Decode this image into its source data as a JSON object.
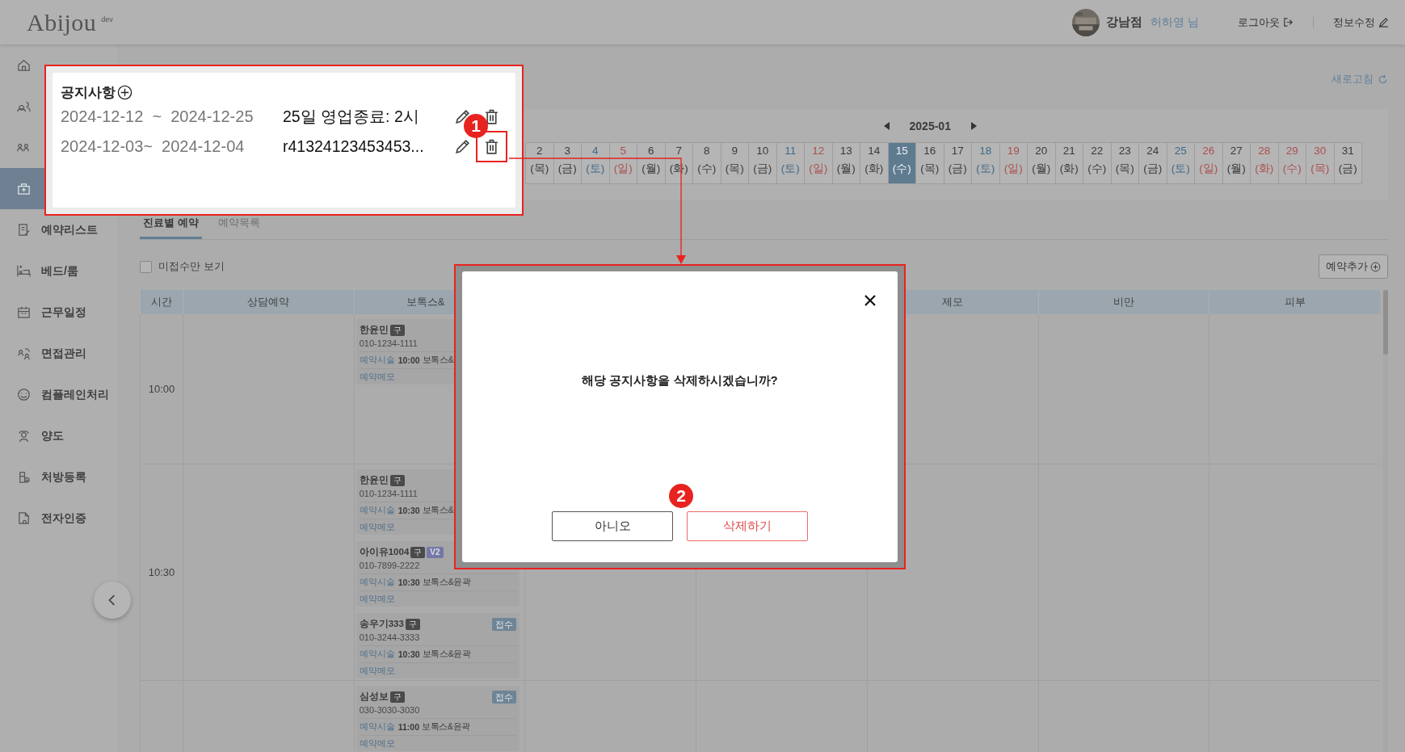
{
  "header": {
    "logo": "Abijou",
    "logo_tag": "dev",
    "branch": "강남점",
    "user": "허하영 님",
    "logout": "로그아웃",
    "edit_profile": "정보수정"
  },
  "sidebar": {
    "items": [
      {
        "selected": false
      },
      {
        "selected": false
      },
      {
        "selected": false
      },
      {
        "selected": true
      },
      {
        "label": "예약리스트",
        "selected": false
      },
      {
        "label": "베드/룸",
        "selected": false
      },
      {
        "label": "근무일정",
        "selected": false
      },
      {
        "label": "면접관리",
        "selected": false
      },
      {
        "label": "컴플레인처리",
        "selected": false
      },
      {
        "label": "양도",
        "selected": false
      },
      {
        "label": "처방등록",
        "selected": false
      },
      {
        "label": "전자인증",
        "selected": false
      }
    ]
  },
  "refresh": "새로고침",
  "calendar": {
    "month": "2025-01",
    "days": [
      {
        "day": "2",
        "weekday": "(목)",
        "kind": "weekday",
        "selected": false
      },
      {
        "day": "3",
        "weekday": "(금)",
        "kind": "weekday",
        "selected": false
      },
      {
        "day": "4",
        "weekday": "(토)",
        "kind": "saturday",
        "selected": false
      },
      {
        "day": "5",
        "weekday": "(일)",
        "kind": "holiday",
        "selected": false
      },
      {
        "day": "6",
        "weekday": "(월)",
        "kind": "weekday",
        "selected": false
      },
      {
        "day": "7",
        "weekday": "(화)",
        "kind": "weekday",
        "selected": false
      },
      {
        "day": "8",
        "weekday": "(수)",
        "kind": "weekday",
        "selected": false
      },
      {
        "day": "9",
        "weekday": "(목)",
        "kind": "weekday",
        "selected": false
      },
      {
        "day": "10",
        "weekday": "(금)",
        "kind": "weekday",
        "selected": false
      },
      {
        "day": "11",
        "weekday": "(토)",
        "kind": "saturday",
        "selected": false
      },
      {
        "day": "12",
        "weekday": "(일)",
        "kind": "holiday",
        "selected": false
      },
      {
        "day": "13",
        "weekday": "(월)",
        "kind": "weekday",
        "selected": false
      },
      {
        "day": "14",
        "weekday": "(화)",
        "kind": "weekday",
        "selected": false
      },
      {
        "day": "15",
        "weekday": "(수)",
        "kind": "weekday",
        "selected": true
      },
      {
        "day": "16",
        "weekday": "(목)",
        "kind": "weekday",
        "selected": false
      },
      {
        "day": "17",
        "weekday": "(금)",
        "kind": "weekday",
        "selected": false
      },
      {
        "day": "18",
        "weekday": "(토)",
        "kind": "saturday",
        "selected": false
      },
      {
        "day": "19",
        "weekday": "(일)",
        "kind": "holiday",
        "selected": false
      },
      {
        "day": "20",
        "weekday": "(월)",
        "kind": "weekday",
        "selected": false
      },
      {
        "day": "21",
        "weekday": "(화)",
        "kind": "weekday",
        "selected": false
      },
      {
        "day": "22",
        "weekday": "(수)",
        "kind": "weekday",
        "selected": false
      },
      {
        "day": "23",
        "weekday": "(목)",
        "kind": "weekday",
        "selected": false
      },
      {
        "day": "24",
        "weekday": "(금)",
        "kind": "weekday",
        "selected": false
      },
      {
        "day": "25",
        "weekday": "(토)",
        "kind": "saturday",
        "selected": false
      },
      {
        "day": "26",
        "weekday": "(일)",
        "kind": "holiday",
        "selected": false
      },
      {
        "day": "27",
        "weekday": "(월)",
        "kind": "weekday",
        "selected": false
      },
      {
        "day": "28",
        "weekday": "(화)",
        "kind": "holiday",
        "selected": false
      },
      {
        "day": "29",
        "weekday": "(수)",
        "kind": "holiday",
        "selected": false
      },
      {
        "day": "30",
        "weekday": "(목)",
        "kind": "holiday",
        "selected": false
      },
      {
        "day": "31",
        "weekday": "(금)",
        "kind": "weekday",
        "selected": false
      }
    ]
  },
  "tabs": [
    {
      "label": "진료별 예약",
      "selected": true
    },
    {
      "label": "예약목록",
      "selected": false
    }
  ],
  "filter": {
    "label": "미접수만 보기",
    "checked": false
  },
  "add_button": "예약추가",
  "table": {
    "columns": [
      {
        "label": "시간"
      },
      {
        "label": "상담예약"
      },
      {
        "label": "보톡스&",
        "kind": "cut"
      },
      {},
      {},
      {
        "label": "제모"
      },
      {
        "label": "비만"
      },
      {
        "label": "피부"
      }
    ],
    "rows": [
      {
        "time": "10:00",
        "bookings": [
          {
            "name": "한윤민",
            "tag": "구",
            "phone": "010-1234-1111",
            "proc_label": "예약시술",
            "proc_time": "10:00",
            "proc": "보톡스&",
            "memo": "예약메모"
          }
        ]
      },
      {
        "time": "10:30",
        "bookings": [
          {
            "name": "한윤민",
            "tag": "구",
            "phone": "010-1234-1111",
            "proc_label": "예약시술",
            "proc_time": "10:30",
            "proc": "보톡스&",
            "memo": "예약메모"
          },
          {
            "name": "아이유1004",
            "tag": "구",
            "badge": "V2",
            "phone": "010-7899-2222",
            "proc_label": "예약시술",
            "proc_time": "10:30",
            "proc": "보톡스&윤곽",
            "memo": "예약메모"
          },
          {
            "name": "송우기333",
            "tag": "구",
            "status": "접수",
            "phone": "010-3244-3333",
            "proc_label": "예약시술",
            "proc_time": "10:30",
            "proc": "보톡스&윤곽",
            "memo": "예약메모"
          }
        ]
      },
      {
        "bookings": [
          {
            "name": "심성보",
            "tag": "구",
            "status": "접수",
            "phone": "030-3030-3030",
            "proc_label": "예약시술",
            "proc_time": "11:00",
            "proc": "보톡스&윤곽",
            "memo": "예약메모"
          }
        ]
      }
    ]
  },
  "notice": {
    "title": "공지사항",
    "items": [
      {
        "range": "2024-12-12  ~  2024-12-25",
        "text": "25일 영업종료: 2시",
        "highlighted": false
      },
      {
        "range": "2024-12-03~  2024-12-04",
        "text": "r41324123453453...",
        "highlighted": true
      }
    ]
  },
  "modal": {
    "message": "해당 공지사항을 삭제하시겠습니까?",
    "buttons": [
      {
        "label": "아니오",
        "kind": "cancel"
      },
      {
        "label": "삭제하기",
        "kind": "danger"
      }
    ]
  },
  "steps": [
    {
      "label": "1"
    },
    {
      "label": "2"
    }
  ]
}
